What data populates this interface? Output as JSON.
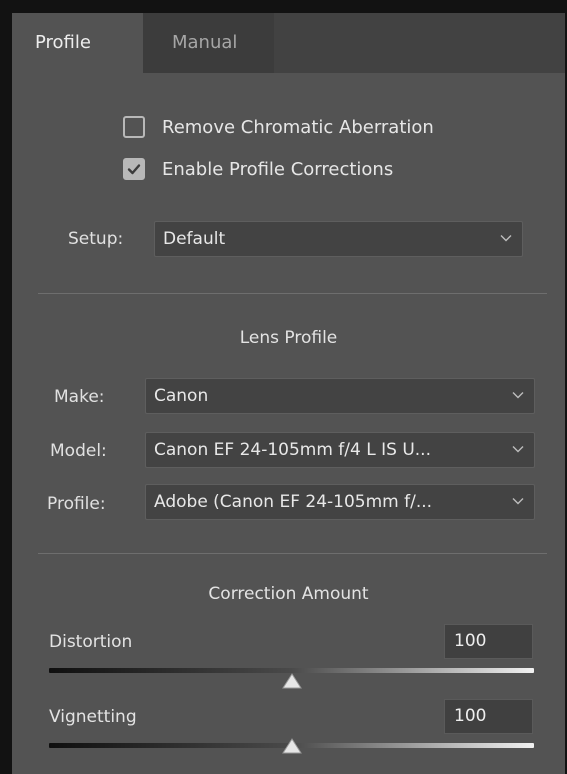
{
  "tabs": [
    {
      "label": "Profile",
      "active": true
    },
    {
      "label": "Manual",
      "active": false
    }
  ],
  "checkboxes": {
    "remove_ca": {
      "label": "Remove Chromatic Aberration",
      "checked": false
    },
    "enable_profile": {
      "label": "Enable Profile Corrections",
      "checked": true
    }
  },
  "setup": {
    "label": "Setup:",
    "value": "Default"
  },
  "lens_profile": {
    "title": "Lens Profile",
    "make": {
      "label": "Make:",
      "value": "Canon"
    },
    "model": {
      "label": "Model:",
      "value": "Canon EF 24-105mm f/4 L IS U..."
    },
    "profile": {
      "label": "Profile:",
      "value": "Adobe (Canon EF 24-105mm f/..."
    }
  },
  "correction_amount": {
    "title": "Correction Amount",
    "distortion": {
      "label": "Distortion",
      "value": "100",
      "fraction": 0.5
    },
    "vignetting": {
      "label": "Vignetting",
      "value": "100",
      "fraction": 0.5
    }
  },
  "icons": {
    "checkmark": "checkmark-icon",
    "dropdown": "chevron-down-icon",
    "slider_thumb": "triangle-up-icon"
  },
  "colors": {
    "panel_bg": "#535353",
    "field_bg": "#434343",
    "text": "#e6e6e6"
  }
}
